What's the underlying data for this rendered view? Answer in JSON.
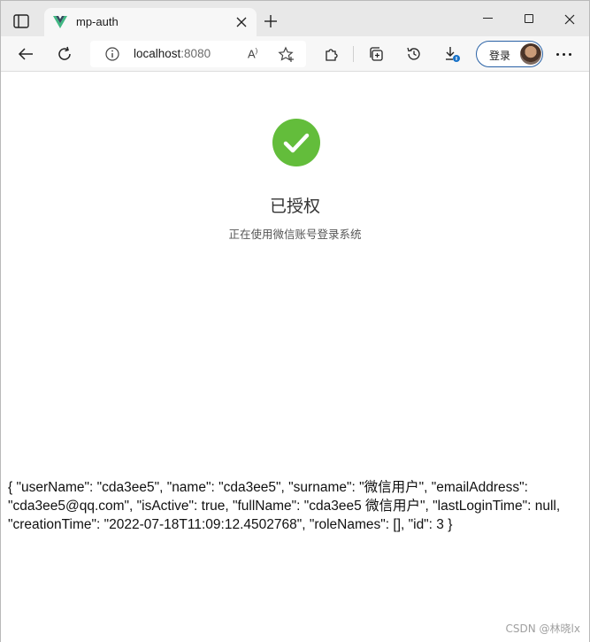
{
  "browser": {
    "tab": {
      "title": "mp-auth",
      "favicon": "vue-logo-icon"
    },
    "address": {
      "host": "localhost",
      "port": ":8080"
    },
    "read_aloud": "Aʹ",
    "profile_button": {
      "label": "登录"
    }
  },
  "page": {
    "status_icon": "check-circle-icon",
    "status_color": "#63bd3b",
    "title": "已授权",
    "subtitle": "正在使用微信账号登录系统",
    "user_json": "{ \"userName\": \"cda3ee5\", \"name\": \"cda3ee5\", \"surname\": \"微信用户\", \"emailAddress\": \"cda3ee5@qq.com\", \"isActive\": true, \"fullName\": \"cda3ee5 微信用户\", \"lastLoginTime\": null, \"creationTime\": \"2022-07-18T11:09:12.4502768\", \"roleNames\": [], \"id\": 3 }"
  },
  "watermark": "CSDN @林晓lx"
}
